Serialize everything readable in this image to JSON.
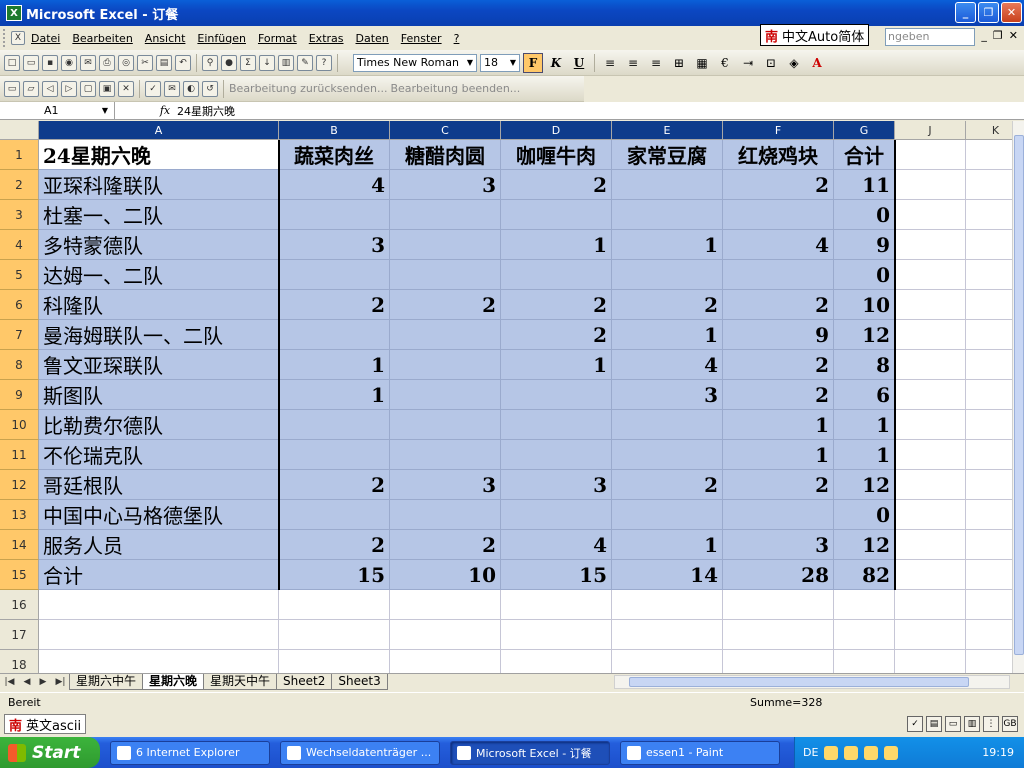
{
  "window": {
    "title": "Microsoft Excel - 订餐",
    "app_icon": "excel-icon"
  },
  "menu": {
    "items": [
      "Datei",
      "Bearbeiten",
      "Ansicht",
      "Einfügen",
      "Format",
      "Extras",
      "Daten",
      "Fenster",
      "?"
    ],
    "ask_placeholder": "ngeben"
  },
  "ime_float": {
    "label": "中文Auto简体",
    "logo": "南"
  },
  "toolbar": {
    "font_name": "Times New Roman",
    "font_size": "18",
    "bold": "F",
    "italic": "K",
    "underline": "U",
    "euro": "€",
    "review_1": "Bearbeitung zurücksenden...",
    "review_2": "Bearbeitung beenden..."
  },
  "formula": {
    "name_box": "A1",
    "fx": "fx",
    "content": "24星期六晚"
  },
  "columns": [
    "A",
    "B",
    "C",
    "D",
    "E",
    "F",
    "G",
    "J",
    "K"
  ],
  "header_row": [
    "24星期六晚",
    "蔬菜肉丝",
    "糖醋肉圆",
    "咖喱牛肉",
    "家常豆腐",
    "红烧鸡块",
    "合计"
  ],
  "rows": [
    {
      "n": "2",
      "cells": [
        "亚琛科隆联队",
        "4",
        "3",
        "2",
        "",
        "2",
        "11"
      ]
    },
    {
      "n": "3",
      "cells": [
        "杜塞一、二队",
        "",
        "",
        "",
        "",
        "",
        "0"
      ]
    },
    {
      "n": "4",
      "cells": [
        "多特蒙德队",
        "3",
        "",
        "1",
        "1",
        "4",
        "9"
      ]
    },
    {
      "n": "5",
      "cells": [
        "达姆一、二队",
        "",
        "",
        "",
        "",
        "",
        "0"
      ]
    },
    {
      "n": "6",
      "cells": [
        "科隆队",
        "2",
        "2",
        "2",
        "2",
        "2",
        "10"
      ]
    },
    {
      "n": "7",
      "cells": [
        "曼海姆联队一、二队",
        "",
        "",
        "2",
        "1",
        "9",
        "12"
      ]
    },
    {
      "n": "8",
      "cells": [
        "鲁文亚琛联队",
        "1",
        "",
        "1",
        "4",
        "2",
        "8"
      ]
    },
    {
      "n": "9",
      "cells": [
        "斯图队",
        "1",
        "",
        "",
        "3",
        "2",
        "6"
      ]
    },
    {
      "n": "10",
      "cells": [
        "比勒费尔德队",
        "",
        "",
        "",
        "",
        "1",
        "1"
      ]
    },
    {
      "n": "11",
      "cells": [
        "不伦瑞克队",
        "",
        "",
        "",
        "",
        "1",
        "1"
      ]
    },
    {
      "n": "12",
      "cells": [
        "哥廷根队",
        "2",
        "3",
        "3",
        "2",
        "2",
        "12"
      ]
    },
    {
      "n": "13",
      "cells": [
        "中国中心马格德堡队",
        "",
        "",
        "",
        "",
        "",
        "0"
      ]
    },
    {
      "n": "14",
      "cells": [
        "服务人员",
        "2",
        "2",
        "4",
        "1",
        "3",
        "12"
      ]
    },
    {
      "n": "15",
      "cells": [
        "合计",
        "15",
        "10",
        "15",
        "14",
        "28",
        "82"
      ]
    },
    {
      "n": "16",
      "cells": [
        "",
        "",
        "",
        "",
        "",
        "",
        ""
      ]
    },
    {
      "n": "17",
      "cells": [
        "",
        "",
        "",
        "",
        "",
        "",
        ""
      ]
    },
    {
      "n": "18",
      "cells": [
        "",
        "",
        "",
        "",
        "",
        "",
        ""
      ]
    }
  ],
  "sheets": [
    "星期六中午",
    "星期六晚",
    "星期天中午",
    "Sheet2",
    "Sheet3"
  ],
  "active_sheet": "星期六晚",
  "status": {
    "ready": "Bereit",
    "sum": "Summe=328"
  },
  "ime_bar": {
    "logo": "南",
    "label": "英文ascii"
  },
  "taskbar": {
    "start": "Start",
    "items": [
      "6 Internet Explorer",
      "Wechseldatenträger ...",
      "Microsoft Excel - 订餐",
      "essen1 - Paint"
    ],
    "lang": "DE",
    "clock": "19:19"
  },
  "colors": {
    "selection": "#b6c6e6",
    "selected_header": "#ffc869",
    "title_bar": "#0a5fd8"
  }
}
